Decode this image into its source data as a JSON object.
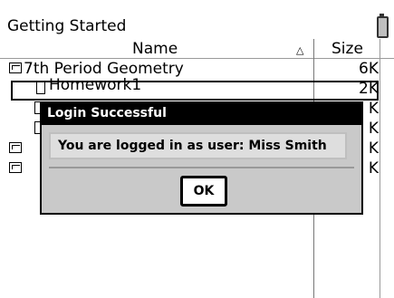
{
  "header": {
    "title": "Getting Started",
    "battery_icon": "battery-icon"
  },
  "columns": {
    "name": "Name",
    "sort_indicator": "△",
    "size": "Size"
  },
  "files": [
    {
      "name": "7th Period Geometry",
      "size": "6K",
      "type": "folder-icon"
    },
    {
      "name": "Homework1",
      "size": "2K",
      "type": "document-icon"
    },
    {
      "name": "",
      "size": "K",
      "type": "document-icon"
    },
    {
      "name": "",
      "size": "K",
      "type": "document-icon"
    },
    {
      "name": "",
      "size": "K",
      "type": "folder-icon"
    },
    {
      "name": "",
      "size": "K",
      "type": "folder-icon"
    }
  ],
  "dialog": {
    "title": "Login Successful",
    "message": "You are logged in as user: Miss Smith",
    "ok_label": "OK"
  }
}
